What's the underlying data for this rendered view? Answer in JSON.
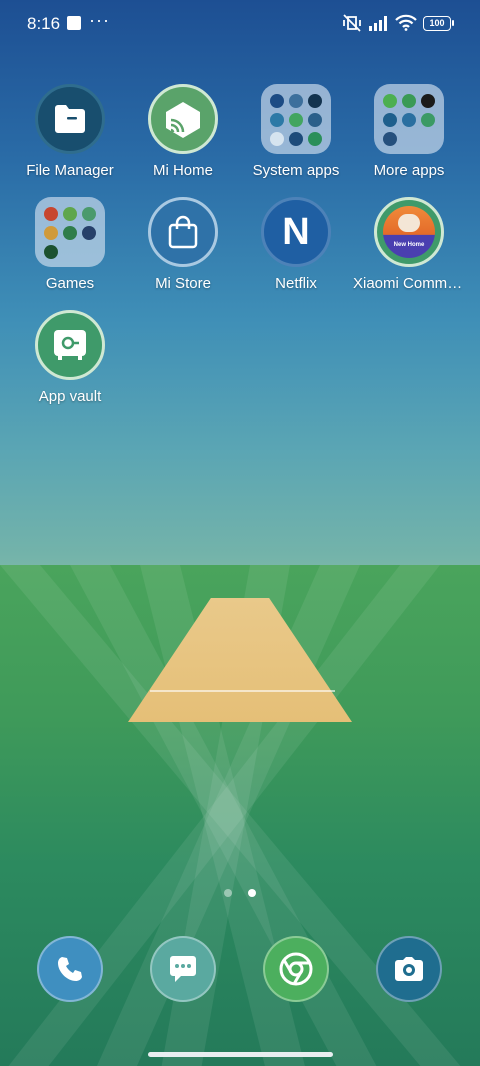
{
  "status": {
    "time": "8:16",
    "battery": "100",
    "more": "···"
  },
  "apps": [
    {
      "label": "File Manager"
    },
    {
      "label": "Mi Home"
    },
    {
      "label": "System apps"
    },
    {
      "label": "More apps"
    },
    {
      "label": "Games"
    },
    {
      "label": "Mi Store"
    },
    {
      "label": "Netflix",
      "glyph": "N"
    },
    {
      "label": "Xiaomi Community",
      "badge": "New Home"
    },
    {
      "label": "App vault"
    }
  ],
  "dock": [
    {
      "name": "Phone"
    },
    {
      "name": "Messages"
    },
    {
      "name": "Chrome"
    },
    {
      "name": "Camera"
    }
  ],
  "pager": {
    "pages": 2,
    "active": 2
  },
  "colors": {
    "file_manager": "#184e6e",
    "mi_home": "#5aa36a",
    "netflix": "#1f5fa3",
    "app_vault": "#3f9a6a"
  }
}
